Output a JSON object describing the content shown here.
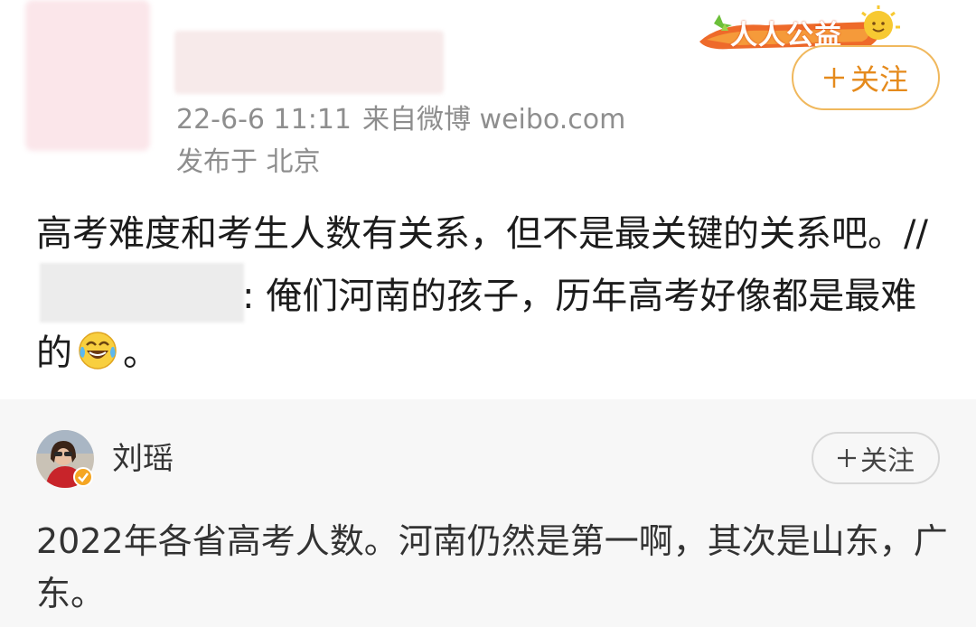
{
  "post": {
    "timestamp": "22-6-6 11:11",
    "source": "来自微博 weibo.com",
    "location": "发布于 北京",
    "badge_text": "人人公益",
    "follow_label": "关注",
    "text_part1": "高考难度和考生人数有关系，但不是最关键的关系吧。//",
    "text_part2": ": 俺们河南的孩子，历年高考好像都是最难的",
    "text_part3": "。",
    "emoji": "laugh-crying-icon"
  },
  "repost": {
    "author": "刘瑶",
    "follow_label": "关注",
    "text": "2022年各省高考人数。河南仍然是第一啊，其次是山东，广东。"
  },
  "colors": {
    "follow_orange": "#e58a1c",
    "follow_border": "#f0b85d",
    "meta_gray": "#8e8e8e",
    "repost_bg": "#f7f7f7"
  }
}
